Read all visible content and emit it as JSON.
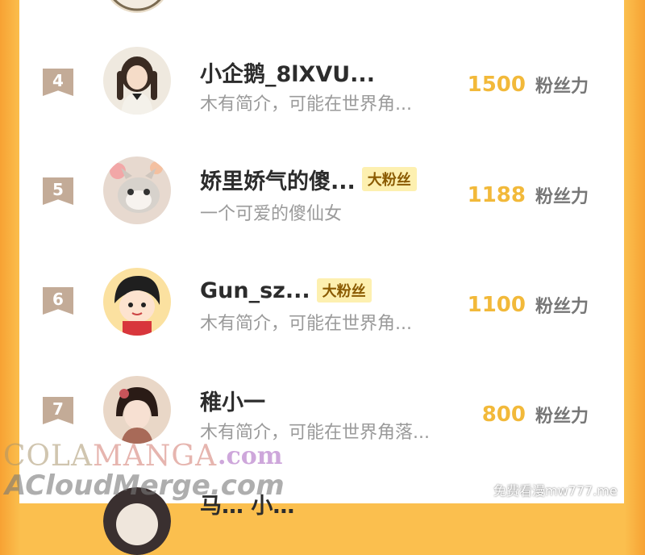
{
  "rankings": [
    {
      "rank": "4",
      "name": "小企鹅_8lXVU...",
      "badge": "",
      "bio": "木有简介，可能在世界角...",
      "fans": "1500",
      "fans_label": "粉丝力"
    },
    {
      "rank": "5",
      "name": "娇里娇气的傻...",
      "badge": "大粉丝",
      "bio": "一个可爱的傻仙女",
      "fans": "1188",
      "fans_label": "粉丝力"
    },
    {
      "rank": "6",
      "name": "Gun_sz...",
      "badge": "大粉丝",
      "bio": "木有简介，可能在世界角...",
      "fans": "1100",
      "fans_label": "粉丝力"
    },
    {
      "rank": "7",
      "name": "稚小一",
      "badge": "",
      "bio": "木有简介，可能在世界角落...",
      "fans": "800",
      "fans_label": "粉丝力"
    }
  ],
  "partial_next_name": "马… 小…",
  "watermarks": {
    "cola": "COLA",
    "manga": "MANGA",
    "com": ".com",
    "acloud": "ACloudMerge.com",
    "site": "免费看漫mw777.me"
  },
  "colors": {
    "frame": "#fbbf4e",
    "rank_bg": "#c3ab97",
    "fans_number": "#f2b93a",
    "badge_bg": "#fdf0b0"
  }
}
